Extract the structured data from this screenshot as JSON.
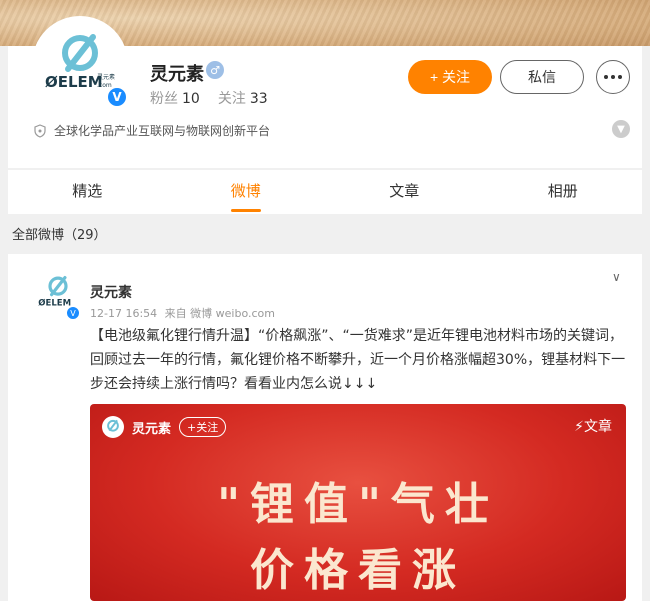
{
  "profile": {
    "name": "灵元素",
    "fans_label": "粉丝",
    "fans_count": "10",
    "follow_label": "关注",
    "follow_count": "33",
    "description": "全球化学品产业互联网与物联网创新平台",
    "logo_text": "ØELEM",
    "logo_sub": "灵元素",
    "logo_domain": ".com"
  },
  "actions": {
    "follow": "+ 关注",
    "message": "私信"
  },
  "tabs": [
    {
      "label": "精选"
    },
    {
      "label": "微博"
    },
    {
      "label": "文章"
    },
    {
      "label": "相册"
    }
  ],
  "feed": {
    "count_label": "全部微博（29）"
  },
  "post": {
    "author": "灵元素",
    "date": "12-17 16:54",
    "source": "来自 微博 weibo.com",
    "text": "【电池级氟化锂行情升温】“价格飙涨”、“一货难求”是近年锂电池材料市场的关键词，回顾过去一年的行情，氟化锂价格不断攀升，近一个月价格涨幅超30%，锂基材料下一步还会持续上涨行情吗？看看业内怎么说↓↓↓",
    "media": {
      "author": "灵元素",
      "follow": "+关注",
      "tag": "⚡文章",
      "headline_line1": "\"锂值\"气壮",
      "headline_line2": "价格看涨"
    }
  },
  "colors": {
    "accent": "#ff8200",
    "verified": "#1a8cff",
    "media_bg": "#d42a22"
  }
}
